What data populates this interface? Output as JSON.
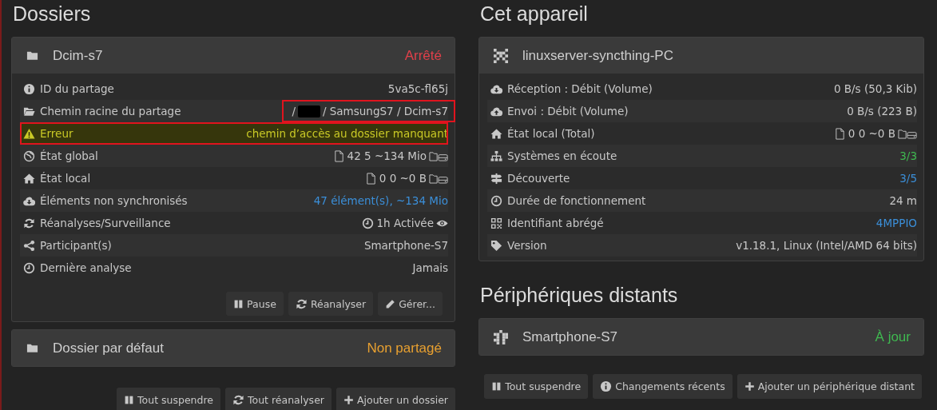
{
  "left": {
    "heading": "Dossiers",
    "folders": [
      {
        "name": "Dcim-s7",
        "status": "Arrêté",
        "color": "#e0404a",
        "rows": [
          {
            "label": "ID du partage",
            "value": "5va5c-fl65j",
            "kind": "text",
            "color": "#c8c8c8",
            "alert": false,
            "annotated": false
          },
          {
            "label": "Chemin racine du partage",
            "prefix": "/",
            "redacted": true,
            "value": "/ SamsungS7 / Dcim-s7",
            "kind": "path",
            "color": "#c8c8c8",
            "alert": false,
            "annotated": false,
            "value_annotated": true
          },
          {
            "label": "Erreur",
            "value": "chemin d’accès au dossier manquant",
            "kind": "text",
            "color": "#c9c926",
            "alert": true,
            "annotated": true
          },
          {
            "label": "État global",
            "value": "42 5 ~134 Mio",
            "kind": "stats",
            "color": "#c8c8c8",
            "alert": false,
            "annotated": false
          },
          {
            "label": "État local",
            "value": "0 0 ~0 B",
            "kind": "stats",
            "color": "#c8c8c8",
            "alert": false,
            "annotated": false
          },
          {
            "label": "Éléments non synchronisés",
            "value": "47 élément(s), ~134 Mio",
            "kind": "text",
            "color": "#3b8fd9",
            "alert": false,
            "annotated": false
          },
          {
            "label": "Réanalyses/Surveillance",
            "value": "1h Activée",
            "kind": "scan",
            "color": "#c8c8c8",
            "alert": false,
            "annotated": false
          },
          {
            "label": "Participant(s)",
            "value": "Smartphone-S7",
            "kind": "text",
            "color": "#c8c8c8",
            "alert": false,
            "annotated": false
          },
          {
            "label": "Dernière analyse",
            "value": "Jamais",
            "kind": "text",
            "color": "#c8c8c8",
            "alert": false,
            "annotated": false
          }
        ],
        "buttons": [
          "Pause",
          "Réanalyser",
          "Gérer..."
        ]
      },
      {
        "name": "Dossier par défaut",
        "status": "Non partagé",
        "color": "#e8a030"
      }
    ],
    "buttons": [
      "Tout suspendre",
      "Tout réanalyser",
      "Ajouter un dossier"
    ]
  },
  "right": {
    "heading": "Cet appareil",
    "device": {
      "name": "linuxserver-syncthing-PC",
      "rows": [
        {
          "label": "Réception : Débit (Volume)",
          "value": "0 B/s (50,3 Kib)",
          "kind": "text",
          "color": "#c8c8c8"
        },
        {
          "label": "Envoi : Débit (Volume)",
          "value": "0 B/s (223 B)",
          "kind": "text",
          "color": "#c8c8c8"
        },
        {
          "label": "État local (Total)",
          "value": "0 0 ~0 B",
          "kind": "stats",
          "color": "#c8c8c8"
        },
        {
          "label": "Systèmes en écoute",
          "value": "3/3",
          "kind": "text",
          "color": "#3fb950"
        },
        {
          "label": "Découverte",
          "value": "3/5",
          "kind": "text",
          "color": "#3b8fd9"
        },
        {
          "label": "Durée de fonctionnement",
          "value": "24 m",
          "kind": "text",
          "color": "#c8c8c8"
        },
        {
          "label": "Identifiant abrégé",
          "value": "4MPPIO",
          "kind": "text",
          "color": "#3b8fd9"
        },
        {
          "label": "Version",
          "value": "v1.18.1, Linux (Intel/AMD 64 bits)",
          "kind": "text",
          "color": "#c8c8c8"
        }
      ]
    },
    "remote_heading": "Périphériques distants",
    "remotes": [
      {
        "name": "Smartphone-S7",
        "status": "À jour",
        "color": "#3fb950"
      }
    ],
    "buttons": [
      "Tout suspendre",
      "Changements récents",
      "Ajouter un périphérique distant"
    ]
  }
}
